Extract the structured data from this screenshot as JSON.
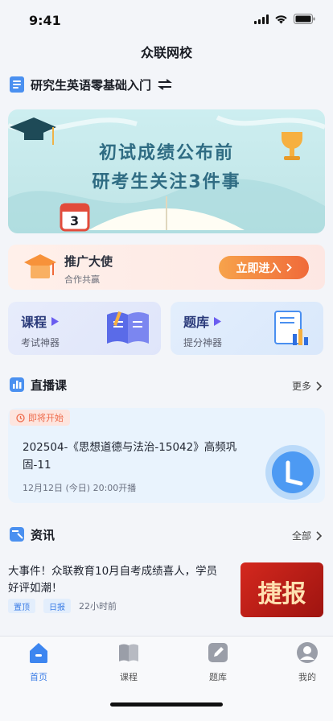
{
  "status": {
    "time": "9:41"
  },
  "header": {
    "title": "众联网校"
  },
  "course_switch": {
    "label": "研究生英语零基础入门"
  },
  "banner": {
    "line1": "初试成绩公布前",
    "line2": "研考生关注3件事",
    "calendar_number": "3"
  },
  "promo": {
    "title": "推广大使",
    "subtitle": "合作共赢",
    "button_label": "立即进入"
  },
  "quick_cards": [
    {
      "title": "课程",
      "subtitle": "考试神器"
    },
    {
      "title": "题库",
      "subtitle": "提分神器"
    }
  ],
  "live": {
    "section_title": "直播课",
    "more_label": "更多",
    "tag": "即将开始",
    "title": "202504-《思想道德与法治-15042》高频巩固-11",
    "time": "12月12日 (今日) 20:00开播"
  },
  "news": {
    "section_title": "资讯",
    "more_label": "全部",
    "items": [
      {
        "title": "大事件！众联教育10月自考成绩喜人，学员好评如潮！",
        "tags": [
          "置顶",
          "日报"
        ],
        "time": "22小时前",
        "thumb_text": "捷报"
      }
    ]
  },
  "tabbar": {
    "items": [
      {
        "label": "首页",
        "active": true
      },
      {
        "label": "课程",
        "active": false
      },
      {
        "label": "题库",
        "active": false
      },
      {
        "label": "我的",
        "active": false
      }
    ]
  },
  "colors": {
    "accent": "#3d7ee6",
    "promo_button": "#f06a3a",
    "banner_text": "#2f6c83"
  }
}
